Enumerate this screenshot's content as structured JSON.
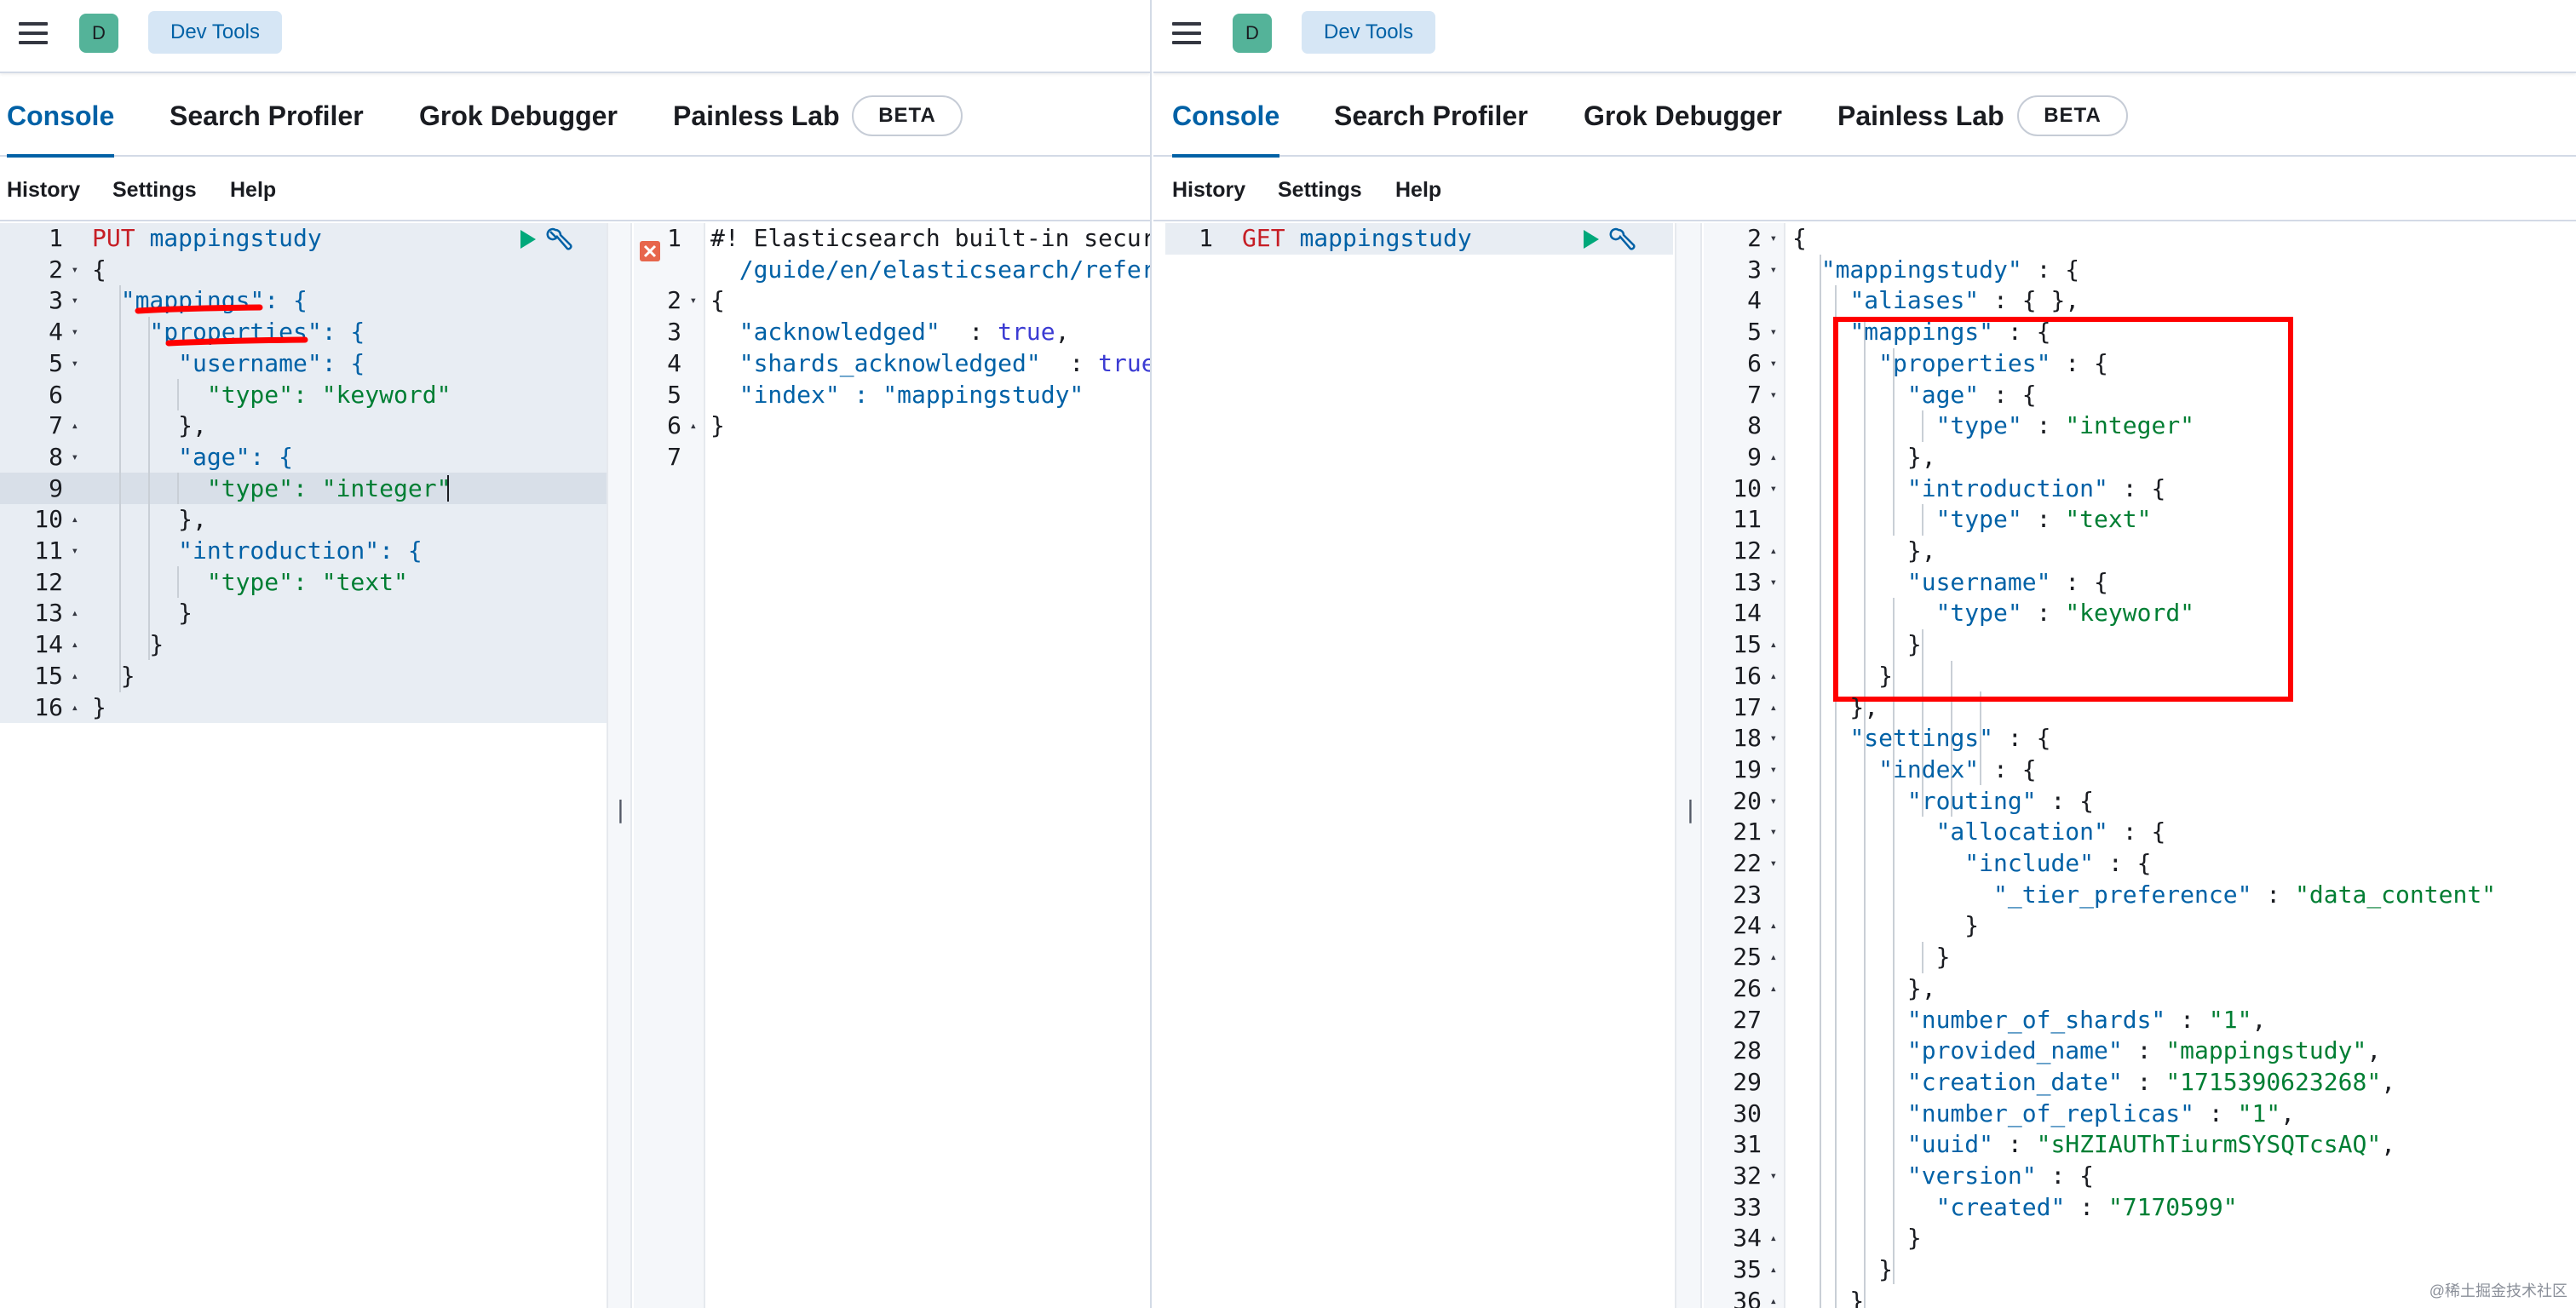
{
  "left": {
    "header": {
      "avatar_letter": "D",
      "breadcrumb": "Dev Tools"
    },
    "tabs": [
      {
        "label": "Console",
        "active": true
      },
      {
        "label": "Search Profiler",
        "active": false
      },
      {
        "label": "Grok Debugger",
        "active": false
      },
      {
        "label": "Painless Lab",
        "active": false
      }
    ],
    "beta_badge": "BETA",
    "menu": [
      "History",
      "Settings",
      "Help"
    ],
    "request": {
      "line_numbers": [
        "1",
        "2",
        "3",
        "4",
        "5",
        "6",
        "7",
        "8",
        "9",
        "10",
        "11",
        "12",
        "13",
        "14",
        "15",
        "16"
      ],
      "method": "PUT",
      "path": "mappingstudy",
      "body_lines": [
        "{",
        "  \"mappings\": {",
        "    \"properties\": {",
        "      \"username\": {",
        "        \"type\": \"keyword\"",
        "      },",
        "      \"age\": {",
        "        \"type\": \"integer\"",
        "      },",
        "      \"introduction\": {",
        "        \"type\": \"text\"",
        "      }",
        "    }",
        "  }",
        "}"
      ]
    },
    "response": {
      "line_numbers": [
        "1",
        "2",
        "3",
        "4",
        "5",
        "6",
        "7"
      ],
      "comment_1": "#! Elasticsearch built-in secur",
      "comment_2": "  /guide/en/elasticsearch/refer",
      "lines": [
        "{",
        "  \"acknowledged\" : true,",
        "  \"shards_acknowledged\" : true,",
        "  \"index\" : \"mappingstudy\"",
        "}",
        ""
      ]
    }
  },
  "right": {
    "header": {
      "avatar_letter": "D",
      "breadcrumb": "Dev Tools"
    },
    "tabs": [
      {
        "label": "Console",
        "active": true
      },
      {
        "label": "Search Profiler",
        "active": false
      },
      {
        "label": "Grok Debugger",
        "active": false
      },
      {
        "label": "Painless Lab",
        "active": false
      }
    ],
    "beta_badge": "BETA",
    "menu": [
      "History",
      "Settings",
      "Help"
    ],
    "request": {
      "line_number": "1",
      "method": "GET",
      "path": "mappingstudy"
    },
    "response": {
      "line_numbers": [
        "2",
        "3",
        "4",
        "5",
        "6",
        "7",
        "8",
        "9",
        "10",
        "11",
        "12",
        "13",
        "14",
        "15",
        "16",
        "17",
        "18",
        "19",
        "20",
        "21",
        "22",
        "23",
        "24",
        "25",
        "26",
        "27",
        "28",
        "29",
        "30",
        "31",
        "32",
        "33",
        "34",
        "35",
        "36"
      ],
      "lines": [
        "{",
        "  \"mappingstudy\" : {",
        "    \"aliases\" : { },",
        "    \"mappings\" : {",
        "      \"properties\" : {",
        "        \"age\" : {",
        "          \"type\" : \"integer\"",
        "        },",
        "        \"introduction\" : {",
        "          \"type\" : \"text\"",
        "        },",
        "        \"username\" : {",
        "          \"type\" : \"keyword\"",
        "        }",
        "      }",
        "    },",
        "    \"settings\" : {",
        "      \"index\" : {",
        "        \"routing\" : {",
        "          \"allocation\" : {",
        "            \"include\" : {",
        "              \"_tier_preference\" : \"data_content\"",
        "            }",
        "          }",
        "        },",
        "        \"number_of_shards\" : \"1\",",
        "        \"provided_name\" : \"mappingstudy\",",
        "        \"creation_date\" : \"1715390623268\",",
        "        \"number_of_replicas\" : \"1\",",
        "        \"uuid\" : \"sHZIAUThTiurmSYSQTcsAQ\",",
        "        \"version\" : {",
        "          \"created\" : \"7170599\"",
        "        }",
        "      }",
        "    }"
      ]
    },
    "watermark": "@稀土掘金技术社区"
  },
  "colors": {
    "accent": "#0061a6",
    "key": "#0061a6",
    "string": "#007e33",
    "method": "#c61e25",
    "annotation": "#ff0000"
  }
}
